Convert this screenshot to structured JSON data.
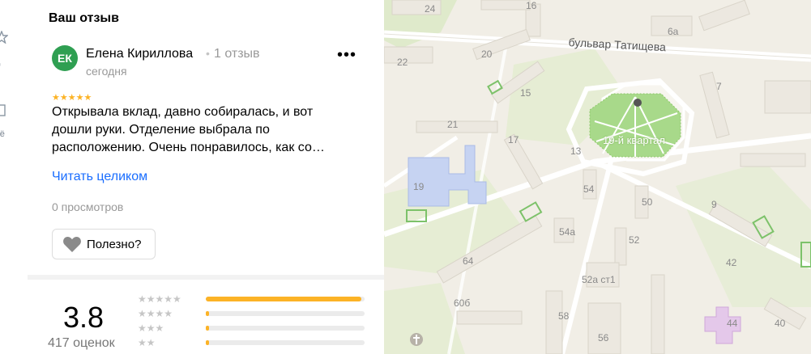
{
  "nav": {
    "item1_label": "д",
    "item2_label": "ьё"
  },
  "review": {
    "section_title": "Ваш отзыв",
    "avatar_initials": "ЕК",
    "author": "Елена Кириллова",
    "separator": "•",
    "review_count": "1 отзыв",
    "date": "сегодня",
    "more_label": "•••",
    "stars": "★★★★★",
    "text_lines": [
      "Открывала вклад, давно собиралась, и вот",
      "дошли руки. Отделение выбрала по",
      "расположению. Очень понравилось, как со…"
    ],
    "read_all": "Читать целиком",
    "views": "0 просмотров",
    "useful_label": "Полезно?"
  },
  "rating": {
    "value": "3.8",
    "count_label": "417 оценок",
    "histogram": [
      {
        "stars": "★★★★★",
        "share": 0.98
      },
      {
        "stars": "★★★★",
        "share": 0.02
      },
      {
        "stars": "★★★",
        "share": 0.02
      },
      {
        "stars": "★★",
        "share": 0.02
      }
    ]
  },
  "map": {
    "street": "бульвар Татищева",
    "park": "19-й квартал",
    "numbers": [
      "24",
      "16",
      "6а",
      "22",
      "20",
      "15",
      "21",
      "17",
      "13",
      "7",
      "19",
      "54",
      "50",
      "9",
      "54а",
      "52",
      "64",
      "42",
      "52а ст1",
      "60б",
      "58",
      "56",
      "44",
      "40",
      "6а"
    ]
  },
  "colors": {
    "accent_link": "#196dff",
    "star": "#fcb326",
    "avatar": "#2f9f52",
    "park": "#a8d98a"
  }
}
